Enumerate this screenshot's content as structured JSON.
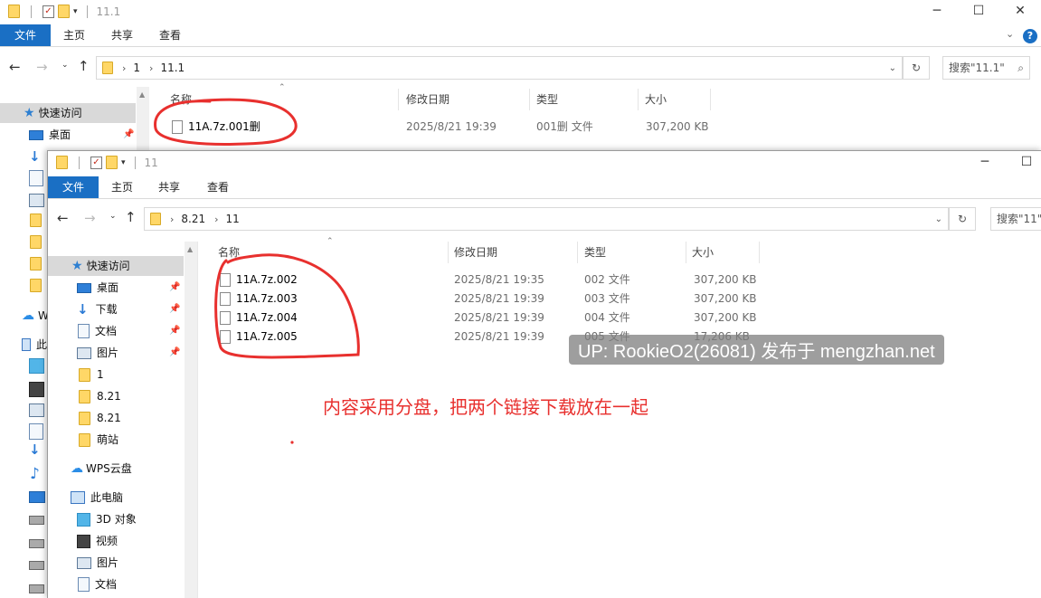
{
  "colors": {
    "accent": "#1a6fc4",
    "annotation": "#e8302e"
  },
  "back_window": {
    "title": "11.1",
    "ribbon_tabs": [
      "文件",
      "主页",
      "共享",
      "查看"
    ],
    "breadcrumb": [
      "1",
      "11.1"
    ],
    "search_placeholder": "搜索\"11.1\"",
    "columns": {
      "name": "名称",
      "modified": "修改日期",
      "type": "类型",
      "size": "大小"
    },
    "files": [
      {
        "name": "11A.7z.001删",
        "modified": "2025/8/21 19:39",
        "type": "001删 文件",
        "size": "307,200 KB"
      }
    ],
    "nav": [
      {
        "label": "快速访问",
        "icon": "star-icon"
      },
      {
        "label": "桌面",
        "icon": "desktop-icon"
      },
      {
        "label": "W",
        "icon": "cloud-icon"
      },
      {
        "label": "此",
        "icon": "pc-icon"
      }
    ],
    "window_controls": [
      "─",
      "☐",
      "✕"
    ]
  },
  "front_window": {
    "title": "11",
    "ribbon_tabs": [
      "文件",
      "主页",
      "共享",
      "查看"
    ],
    "breadcrumb": [
      "8.21",
      "11"
    ],
    "search_placeholder": "搜索\"11\"",
    "columns": {
      "name": "名称",
      "modified": "修改日期",
      "type": "类型",
      "size": "大小"
    },
    "files": [
      {
        "name": "11A.7z.002",
        "modified": "2025/8/21 19:35",
        "type": "002 文件",
        "size": "307,200 KB"
      },
      {
        "name": "11A.7z.003",
        "modified": "2025/8/21 19:39",
        "type": "003 文件",
        "size": "307,200 KB"
      },
      {
        "name": "11A.7z.004",
        "modified": "2025/8/21 19:39",
        "type": "004 文件",
        "size": "307,200 KB"
      },
      {
        "name": "11A.7z.005",
        "modified": "2025/8/21 19:39",
        "type": "005 文件",
        "size": "17,206 KB"
      }
    ],
    "nav": [
      {
        "label": "快速访问",
        "icon": "star-icon"
      },
      {
        "label": "桌面",
        "icon": "desktop-icon"
      },
      {
        "label": "下载",
        "icon": "download-icon"
      },
      {
        "label": "文档",
        "icon": "document-icon"
      },
      {
        "label": "图片",
        "icon": "pictures-icon"
      },
      {
        "label": "1",
        "icon": "folder-icon"
      },
      {
        "label": "8.21",
        "icon": "folder-icon"
      },
      {
        "label": "8.21",
        "icon": "folder-icon"
      },
      {
        "label": "萌站",
        "icon": "folder-icon"
      },
      {
        "label": "WPS云盘",
        "icon": "cloud-icon"
      },
      {
        "label": "此电脑",
        "icon": "pc-icon"
      },
      {
        "label": "3D 对象",
        "icon": "3d-objects-icon"
      },
      {
        "label": "视频",
        "icon": "video-icon"
      },
      {
        "label": "图片",
        "icon": "pictures-icon"
      },
      {
        "label": "文档",
        "icon": "document-icon"
      }
    ],
    "window_controls": [
      "─",
      "☐"
    ]
  },
  "annotation_text": "内容采用分盘，把两个链接下载放在一起",
  "watermark": "UP: RookieO2(26081) 发布于 mengzhan.net"
}
